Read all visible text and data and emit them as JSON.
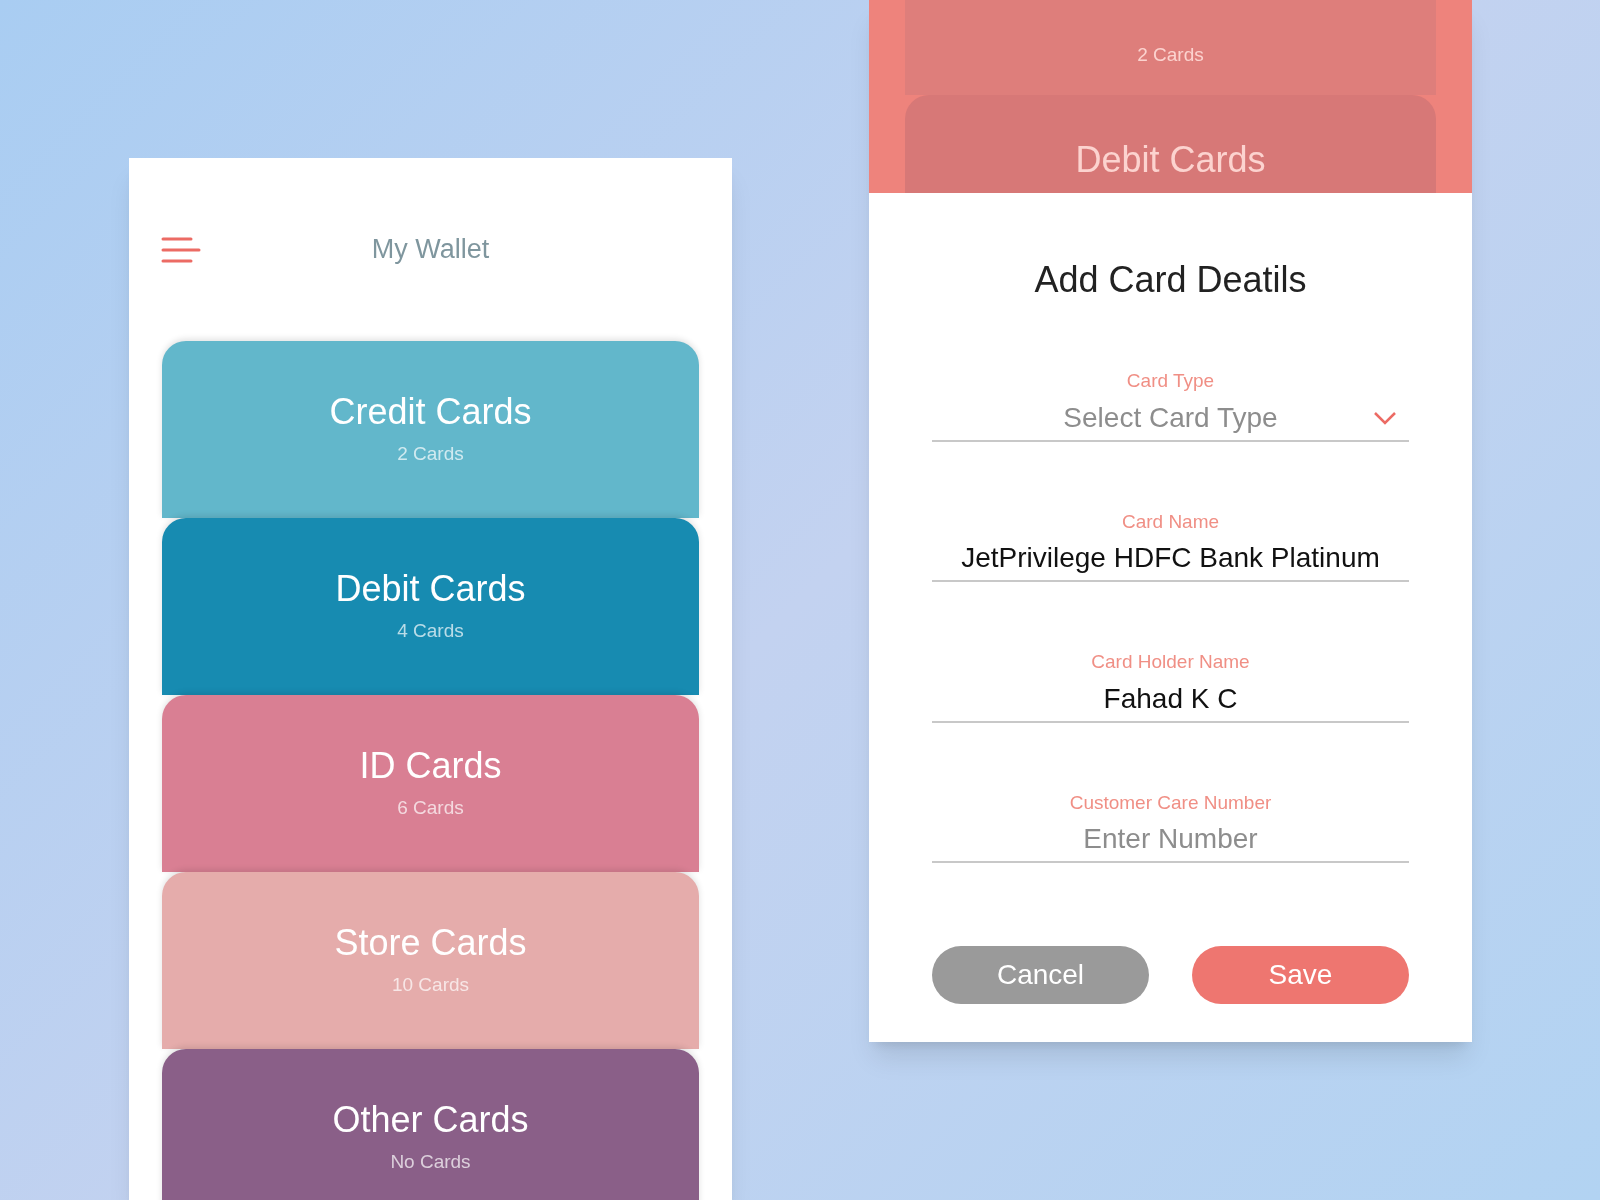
{
  "wallet": {
    "title": "My Wallet",
    "cards": [
      {
        "name": "Credit Cards",
        "count": "2 Cards",
        "color": "#62b7cb"
      },
      {
        "name": "Debit Cards",
        "count": "4 Cards",
        "color": "#178bb1"
      },
      {
        "name": "ID Cards",
        "count": "6 Cards",
        "color": "#d97f93"
      },
      {
        "name": "Store Cards",
        "count": "10 Cards",
        "color": "#e5acab"
      },
      {
        "name": "Other Cards",
        "count": "No Cards",
        "color": "#8a5f88"
      }
    ]
  },
  "backdrop": {
    "count": "2 Cards",
    "next_title": "Debit Cards"
  },
  "form": {
    "title": "Add Card Deatils",
    "fields": [
      {
        "kind": "select",
        "label": "Card Type",
        "placeholder": "Select Card Type"
      },
      {
        "kind": "text",
        "label": "Card Name",
        "value": "JetPrivilege HDFC Bank Platinum"
      },
      {
        "kind": "text",
        "label": "Card Holder Name",
        "value": "Fahad K C"
      },
      {
        "kind": "text",
        "label": "Customer Care Number",
        "placeholder": "Enter Number"
      }
    ],
    "buttons": [
      {
        "kind": "secondary",
        "label": "Cancel"
      },
      {
        "kind": "primary",
        "label": "Save"
      }
    ]
  }
}
